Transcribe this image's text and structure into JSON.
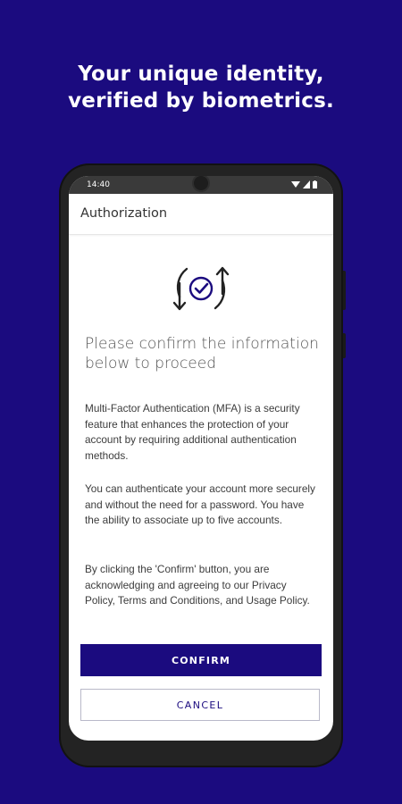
{
  "headline": {
    "line1": "Your unique identity,",
    "line2": "verified by biometrics."
  },
  "statusbar": {
    "time": "14:40",
    "icons": [
      "wifi-icon",
      "signal-icon",
      "battery-icon"
    ]
  },
  "appbar": {
    "title": "Authorization"
  },
  "content": {
    "icon": "sync-check-icon",
    "heading": "Please confirm the information below to proceed",
    "paragraph1": "Multi-Factor Authentication (MFA) is a security feature that enhances the protection of your account by requiring additional authentication methods.",
    "paragraph2": "You can authenticate your account more securely and without the need for a password. You have the ability to associate up to five accounts.",
    "paragraph3": "By clicking the 'Confirm' button, you are acknowledging and agreeing to our Privacy Policy, Terms and Conditions, and Usage Policy."
  },
  "actions": {
    "confirm_label": "CONFIRM",
    "cancel_label": "CANCEL"
  },
  "colors": {
    "brand": "#1b0b7f",
    "background": "#1b0b7f",
    "text": "#3c3c3c"
  }
}
